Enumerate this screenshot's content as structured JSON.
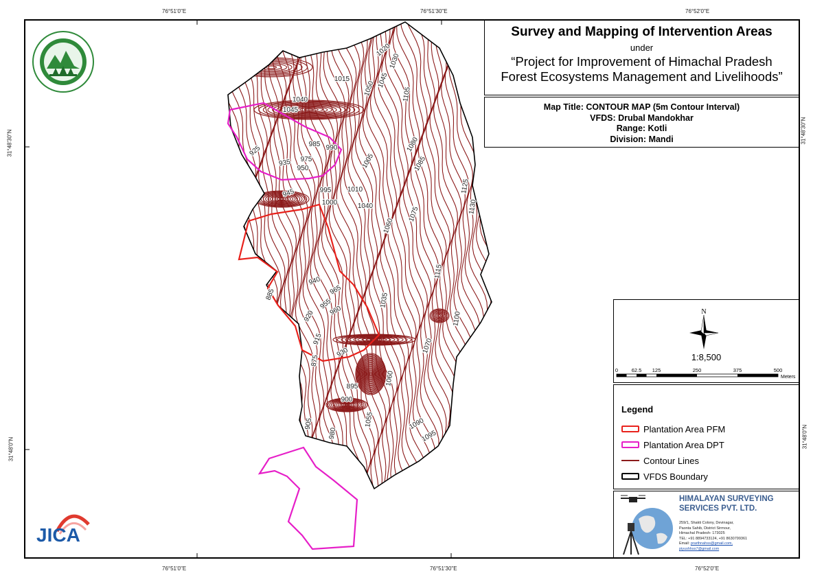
{
  "title": {
    "main": "Survey and Mapping of Intervention Areas",
    "under": "under",
    "project_line1": "“Project for Improvement of Himachal Pradesh",
    "project_line2": "Forest Ecosystems Management and Livelihoods”"
  },
  "info": {
    "map_title": "Map Title: CONTOUR MAP (5m Contour Interval)",
    "vfds": "VFDS: Drubal Mandokhar",
    "range": "Range: Kotli",
    "division": "Division: Mandi"
  },
  "graticule": {
    "top": [
      "76°51'0\"E",
      "76°51'30\"E",
      "76°52'0\"E"
    ],
    "bottom": [
      "76°51'0\"E",
      "76°51'30\"E",
      "76°52'0\"E"
    ],
    "left": [
      "31°48'30\"N",
      "31°48'0\"N"
    ],
    "right": [
      "31°48'30\"N",
      "31°48'0\"N"
    ]
  },
  "north_arrow": {
    "label": "N",
    "icon": "compass-star-icon"
  },
  "scale": {
    "ratio": "1:8,500",
    "ticks": [
      "0",
      "62.5",
      "125",
      "250",
      "375",
      "500"
    ],
    "unit": "Meters"
  },
  "legend": {
    "title": "Legend",
    "items": [
      {
        "label": "Plantation Area PFM",
        "color": "#e8221c",
        "kind": "polygon"
      },
      {
        "label": "Plantation Area DPT",
        "color": "#e61ec8",
        "kind": "polygon"
      },
      {
        "label": "Contour Lines",
        "color": "#8b1a1a",
        "kind": "line"
      },
      {
        "label": "VFDS Boundary",
        "color": "#000000",
        "kind": "polygon"
      }
    ]
  },
  "company": {
    "name_line1": "HIMALAYAN SURVEYING",
    "name_line2": "SERVICES PVT. LTD.",
    "address": [
      "259/1, Shakti Colony, Devinagar,",
      "Paonta Sahib, District Sirmour,",
      "Himachal Pradesh- 173025",
      "TEL: +91 8894733124, +91 8630799361"
    ],
    "email_prefix": "Email: ",
    "email1": "prarthnahss@gmail.com,",
    "email2": "piyushhss7@gmail.com"
  },
  "logos": {
    "jica": "JICA",
    "hp_forest": "hp-forest-department-emblem"
  },
  "contour_labels": [
    "1020",
    "1030",
    "1015",
    "1050",
    "1045",
    "1105",
    "1040",
    "1045",
    "985",
    "990",
    "925",
    "975",
    "935",
    "950",
    "1005",
    "1080",
    "1085",
    "945",
    "995",
    "1010",
    "1000",
    "1040",
    "1060",
    "1075",
    "1125",
    "1130",
    "1115",
    "940",
    "965",
    "885",
    "955",
    "960",
    "920",
    "1035",
    "1100",
    "915",
    "1070",
    "875",
    "930",
    "895",
    "1060",
    "900",
    "905",
    "980",
    "1055",
    "1090",
    "1095"
  ],
  "colors": {
    "contour": "#8b1a1a",
    "pfm": "#e8221c",
    "dpt": "#e61ec8",
    "boundary": "#000000"
  }
}
